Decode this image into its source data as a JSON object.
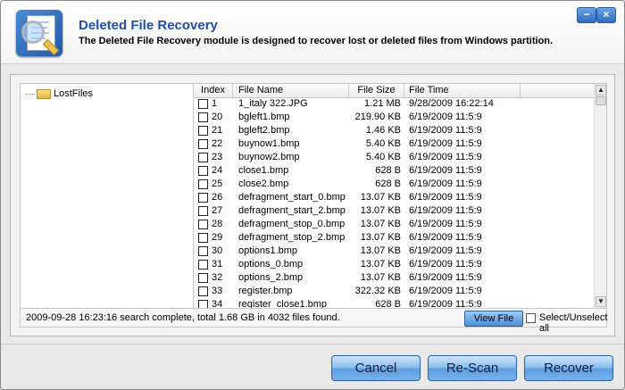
{
  "header": {
    "title": "Deleted File Recovery",
    "subtitle": "The Deleted File Recovery module is designed to recover lost or deleted files from Windows partition."
  },
  "window_controls": {
    "minimize": "−",
    "close": "×"
  },
  "tree": {
    "items": [
      {
        "label": "LostFiles",
        "icon": "folder-icon"
      }
    ]
  },
  "table": {
    "columns": [
      "Index",
      "File Name",
      "File Size",
      "File Time"
    ],
    "rows": [
      [
        "1",
        "1_italy 322.JPG",
        "1.21 MB",
        "9/28/2009 16:22:14"
      ],
      [
        "20",
        "bgleft1.bmp",
        "219.90 KB",
        "6/19/2009 11:5:9"
      ],
      [
        "21",
        "bgleft2.bmp",
        "1.46 KB",
        "6/19/2009 11:5:9"
      ],
      [
        "22",
        "buynow1.bmp",
        "5.40 KB",
        "6/19/2009 11:5:9"
      ],
      [
        "23",
        "buynow2.bmp",
        "5.40 KB",
        "6/19/2009 11:5:9"
      ],
      [
        "24",
        "close1.bmp",
        "628 B",
        "6/19/2009 11:5:9"
      ],
      [
        "25",
        "close2.bmp",
        "628 B",
        "6/19/2009 11:5:9"
      ],
      [
        "26",
        "defragment_start_0.bmp",
        "13.07 KB",
        "6/19/2009 11:5:9"
      ],
      [
        "27",
        "defragment_start_2.bmp",
        "13.07 KB",
        "6/19/2009 11:5:9"
      ],
      [
        "28",
        "defragment_stop_0.bmp",
        "13.07 KB",
        "6/19/2009 11:5:9"
      ],
      [
        "29",
        "defragment_stop_2.bmp",
        "13.07 KB",
        "6/19/2009 11:5:9"
      ],
      [
        "30",
        "options1.bmp",
        "13.07 KB",
        "6/19/2009 11:5:9"
      ],
      [
        "31",
        "options_0.bmp",
        "13.07 KB",
        "6/19/2009 11:5:9"
      ],
      [
        "32",
        "options_2.bmp",
        "13.07 KB",
        "6/19/2009 11:5:9"
      ],
      [
        "33",
        "register.bmp",
        "322.32 KB",
        "6/19/2009 11:5:9"
      ],
      [
        "34",
        "register_close1.bmp",
        "628 B",
        "6/19/2009 11:5:9"
      ]
    ]
  },
  "scrollbar": {
    "up": "▲",
    "down": "▼"
  },
  "status": {
    "text": "2009-09-28 16:23:16 search complete, total 1.68 GB in 4032 files found.",
    "view_file": "View File",
    "select_all": "Select/Unselect all"
  },
  "footer": {
    "cancel": "Cancel",
    "rescan": "Re-Scan",
    "recover": "Recover"
  },
  "colors": {
    "title": "#1f4fa8",
    "button_blue": "#5d9ee0"
  }
}
